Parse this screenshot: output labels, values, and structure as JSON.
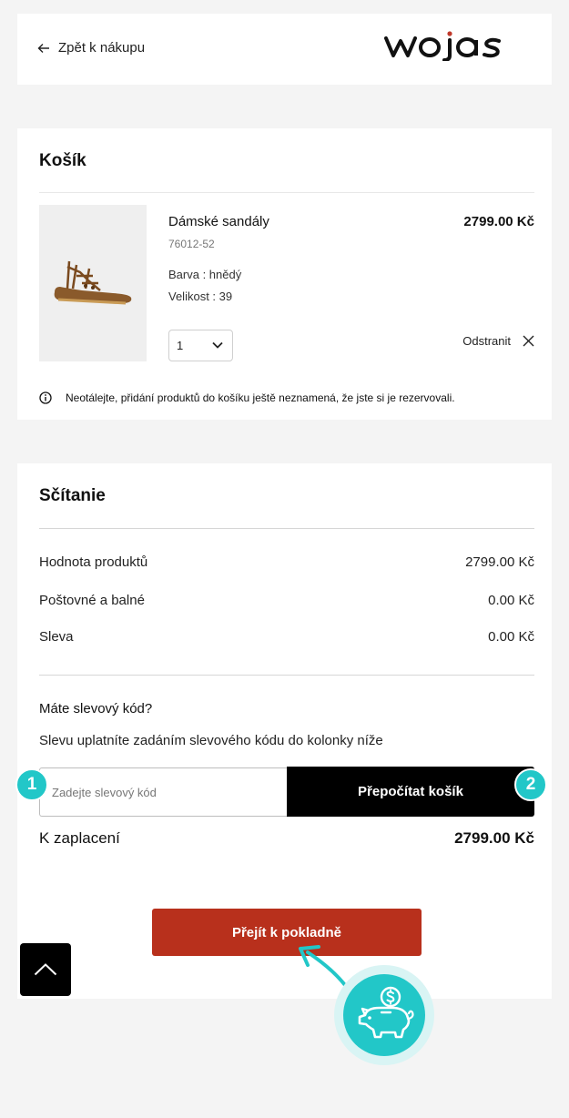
{
  "header": {
    "back_label": "Zpět k nákupu",
    "logo_text": "wojas"
  },
  "cart": {
    "title": "Košík",
    "product": {
      "name": "Dámské sandály",
      "code": "76012-52",
      "color_line": "Barva : hnědý",
      "size_line": "Velikost : 39",
      "price": "2799.00 Kč",
      "quantity": "1",
      "remove_label": "Odstranit"
    },
    "notice": "Neotálejte, přidání produktů do košíku ještě neznamená, že jste si je rezervovali."
  },
  "summary": {
    "title": "Sčítanie",
    "rows": [
      {
        "label": "Hodnota produktů",
        "value": "2799.00 Kč"
      },
      {
        "label": "Poštovné a balné",
        "value": "0.00 Kč"
      },
      {
        "label": "Sleva",
        "value": "0.00 Kč"
      }
    ],
    "coupon_question": "Máte slevový kód?",
    "coupon_hint": "Slevu uplatníte zadáním slevového kódu do kolonky níže",
    "coupon_placeholder": "Zadejte slevový kód",
    "recalc_label": "Přepočítat košík",
    "total_label": "K zaplacení",
    "total_value": "2799.00 Kč",
    "checkout_label": "Přejít k pokladně"
  },
  "annotations": {
    "badge_1": "1",
    "badge_2": "2",
    "accent_color": "#22c7c8"
  },
  "colors": {
    "checkout": "#b8301c",
    "recalc": "#000000",
    "background": "#f4f4f4"
  },
  "icons": [
    "arrow-left-icon",
    "chevron-down-icon",
    "close-icon",
    "info-icon",
    "chevron-up-icon",
    "piggy-bank-icon",
    "dollar-coin-icon",
    "curved-arrow-icon"
  ]
}
